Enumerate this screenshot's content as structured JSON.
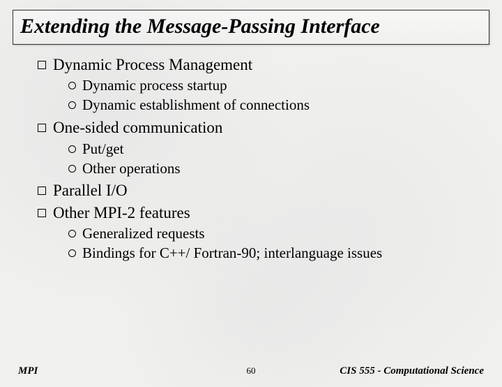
{
  "title": "Extending the Message-Passing Interface",
  "items": [
    {
      "label": "Dynamic Process Management",
      "sub": [
        "Dynamic process startup",
        "Dynamic establishment of connections"
      ]
    },
    {
      "label": "One-sided communication",
      "sub": [
        "Put/get",
        "Other operations"
      ]
    },
    {
      "label": "Parallel I/O",
      "sub": []
    },
    {
      "label": "Other MPI-2 features",
      "sub": [
        "Generalized requests",
        "Bindings for C++/ Fortran-90; interlanguage issues"
      ]
    }
  ],
  "footer": {
    "left": "MPI",
    "center": "60",
    "right": "CIS 555 - Computational Science"
  }
}
